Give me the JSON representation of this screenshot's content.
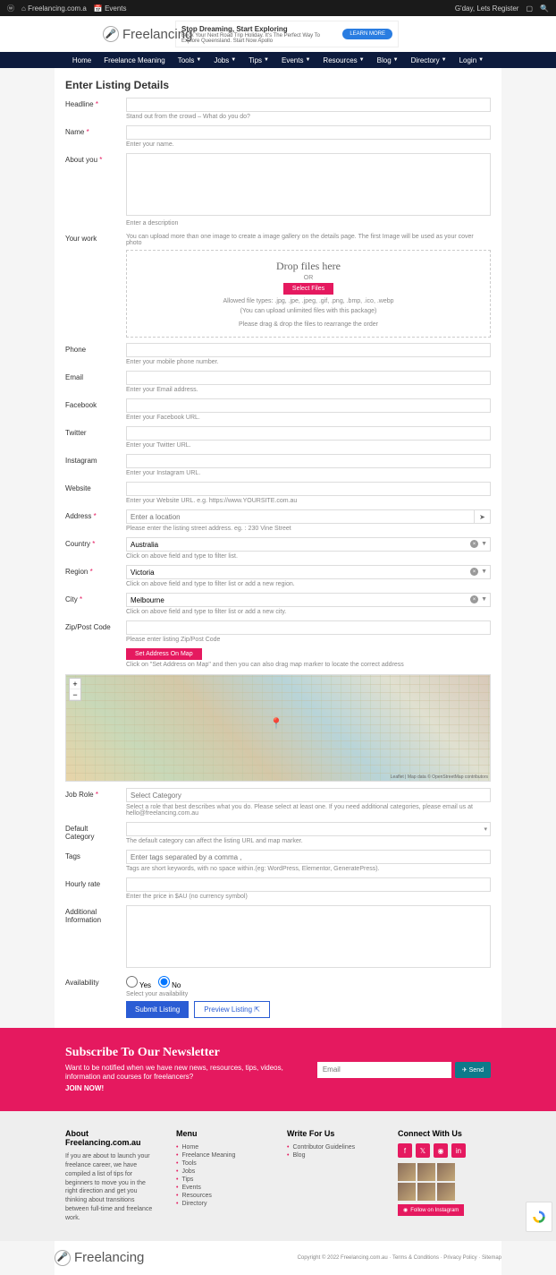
{
  "topbar": {
    "site": "Freelancing.com.a",
    "events": "Events",
    "greeting": "G'day, Lets Register"
  },
  "logo": "Freelancing",
  "ad": {
    "title": "Stop Dreaming, Start Exploring",
    "sub": "Book Your Next Road Trip Holiday. It's The Perfect Way To Explore Queensland. Start Now Apollo",
    "btn": "LEARN MORE"
  },
  "nav": [
    "Home",
    "Freelance Meaning",
    "Tools",
    "Jobs",
    "Tips",
    "Events",
    "Resources",
    "Blog",
    "Directory",
    "Login"
  ],
  "page_title": "Enter Listing Details",
  "fields": {
    "headline": {
      "label": "Headline",
      "hint": "Stand out from the crowd – What do you do?"
    },
    "name": {
      "label": "Name",
      "hint": "Enter your name."
    },
    "about": {
      "label": "About you",
      "hint": "Enter a description"
    },
    "work": {
      "label": "Your work",
      "hint": "You can upload more than one image to create a image gallery on the details page. The first Image will be used as your cover photo"
    },
    "upload": {
      "title": "Drop files here",
      "or": "OR",
      "btn": "Select Files",
      "types": "Allowed file types: .jpg, .jpe, .jpeg, .gif, .png, .bmp, .ico, .webp",
      "pkg": "(You can upload unlimited files with this package)",
      "drag": "Please drag & drop the files to rearrange the order"
    },
    "phone": {
      "label": "Phone",
      "hint": "Enter your mobile phone number."
    },
    "email": {
      "label": "Email",
      "hint": "Enter your Email address."
    },
    "facebook": {
      "label": "Facebook",
      "hint": "Enter your Facebook URL."
    },
    "twitter": {
      "label": "Twitter",
      "hint": "Enter your Twitter URL."
    },
    "instagram": {
      "label": "Instagram",
      "hint": "Enter your Instagram URL."
    },
    "website": {
      "label": "Website",
      "hint": "Enter your Website URL. e.g. https://www.YOURSITE.com.au"
    },
    "address": {
      "label": "Address",
      "placeholder": "Enter a location",
      "hint": "Please enter the listing street address. eg. : 230 Vine Street"
    },
    "country": {
      "label": "Country",
      "value": "Australia",
      "hint": "Click on above field and type to filter list."
    },
    "region": {
      "label": "Region",
      "value": "Victoria",
      "hint": "Click on above field and type to filter list or add a new region."
    },
    "city": {
      "label": "City",
      "value": "Melbourne",
      "hint": "Click on above field and type to filter list or add a new city."
    },
    "zip": {
      "label": "Zip/Post Code",
      "hint": "Please enter listing Zip/Post Code"
    },
    "setaddr": {
      "btn": "Set Address On Map",
      "hint": "Click on \"Set Address on Map\" and then you can also drag map marker to locate the correct address"
    },
    "jobrole": {
      "label": "Job Role",
      "placeholder": "Select Category",
      "hint": "Select a role that best describes what you do. Please select at least one. If you need additional categories, please email us at hello@freelancing.com.au"
    },
    "defcat": {
      "label": "Default Category",
      "hint": "The default category can affect the listing URL and map marker."
    },
    "tags": {
      "label": "Tags",
      "placeholder": "Enter tags separated by a comma ,",
      "hint": "Tags are short keywords, with no space within.(eg: WordPress, Elementor, GeneratePress)."
    },
    "hourly": {
      "label": "Hourly rate",
      "hint": "Enter the price in $AU (no currency symbol)"
    },
    "addinfo": {
      "label": "Additional Information"
    },
    "avail": {
      "label": "Availability",
      "yes": "Yes",
      "no": "No",
      "hint": "Select your availability"
    }
  },
  "map_attr": "Leaflet | Map data © OpenStreetMap contributors",
  "buttons": {
    "submit": "Submit Listing",
    "preview": "Preview Listing"
  },
  "newsletter": {
    "title": "Subscribe To Our Newsletter",
    "text": "Want to be notified when we have new news, resources, tips, videos, information and courses for freelancers?",
    "join": "JOIN NOW!",
    "placeholder": "Email",
    "btn": "Send"
  },
  "footer": {
    "about": {
      "title": "About Freelancing.com.au",
      "text": "If you are about to launch your freelance career, we have compiled a list of tips for beginners to move you in the right direction and get you thinking about transitions between full-time and freelance work."
    },
    "menu": {
      "title": "Menu",
      "items": [
        "Home",
        "Freelance Meaning",
        "Tools",
        "Jobs",
        "Tips",
        "Events",
        "Resources",
        "Directory"
      ]
    },
    "write": {
      "title": "Write For Us",
      "items": [
        "Contributor Guidelines",
        "Blog"
      ]
    },
    "connect": {
      "title": "Connect With Us",
      "insta_btn": "Follow on Instagram"
    }
  },
  "copyright": "Copyright © 2022 Freelancing.com.au · Terms & Conditions · Privacy Policy · Sitemap"
}
